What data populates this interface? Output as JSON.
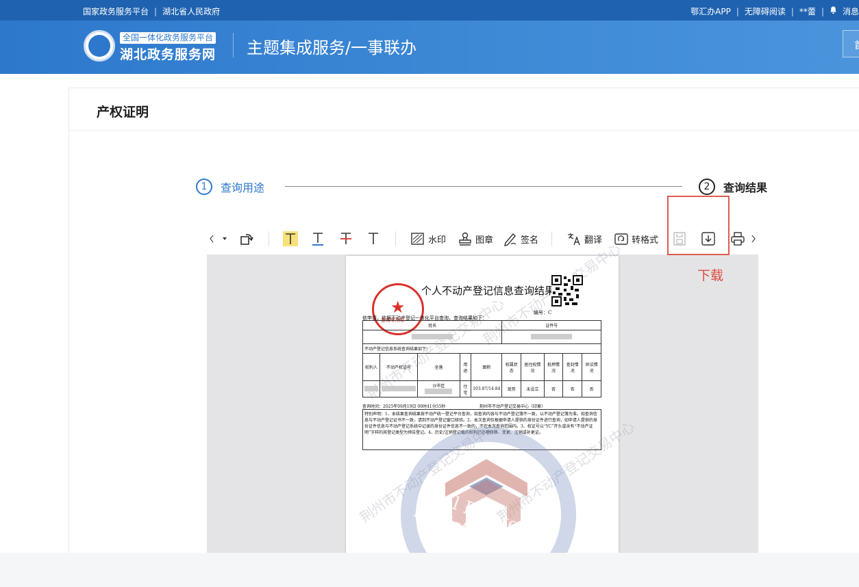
{
  "topbar": {
    "left_links": [
      "国家政务服务平台",
      "湖北省人民政府"
    ],
    "right_links": [
      "鄂汇办APP",
      "无障碍阅读",
      "**蕾"
    ],
    "message_label": "消息"
  },
  "header": {
    "logo_sub": "全国一体化政务服务平台",
    "logo_main": "湖北政务服务网",
    "title": "主题集成服务/一事联办",
    "right_button_char": "首"
  },
  "card": {
    "title": "产权证明"
  },
  "steps": [
    {
      "num": "1",
      "label": "查询用途"
    },
    {
      "num": "2",
      "label": "查询结果"
    }
  ],
  "toolbar": {
    "watermark": "水印",
    "stamp": "图章",
    "sign": "签名",
    "translate": "翻译",
    "convert": "转格式"
  },
  "annotation": {
    "download_label": "下载"
  },
  "document": {
    "title": "个人不动产登记信息查询结果",
    "number_label": "编号：C",
    "seal_text": "查询专用章",
    "preamble": "依申请，依据不动产登记一体化平台查询，查询结果如下：",
    "col_name": "姓名",
    "col_id": "证件号",
    "section_label": "不动产登记信息系统查询结果如下：",
    "headers": [
      "权利人",
      "不动产权证号",
      "坐落",
      "用途",
      "面积",
      "权属状态",
      "居住权情况",
      "抵押情况",
      "查封情况",
      "异议情况"
    ],
    "row": [
      "",
      "",
      "沙市区",
      "住宅",
      "103.87/14.84",
      "现势",
      "未设立",
      "否",
      "否",
      "否"
    ],
    "query_time": "查询时间：2025年09月19日 09时41分55秒",
    "center": "荆州市不动产登记交易中心（印章）",
    "notice": "特别声明：1、本结果查询结果按不动产统一登记平台查询，如查询内容与不动产登记簿不一致，以不动产登记簿为准。如查询信息与不动产登记证书不一致，请到不动产登记窗口核验。2、本次查询仅根据申请人提供的身份证件进行查询，如申请人提供的身份证件信息与不动产登记系统中记录的身份证件信息不一致的，不在本次查询范围内。3、权证号以“YC”开头或含有“不动产证明”字样的其登记类型为预告登记。4、历史/注销登记载的权利已办理转移、变更、注销或补更证。",
    "watermark_text": "Real Estate Registration",
    "watermark_cn": "荆州市不动产登记交易中心"
  }
}
